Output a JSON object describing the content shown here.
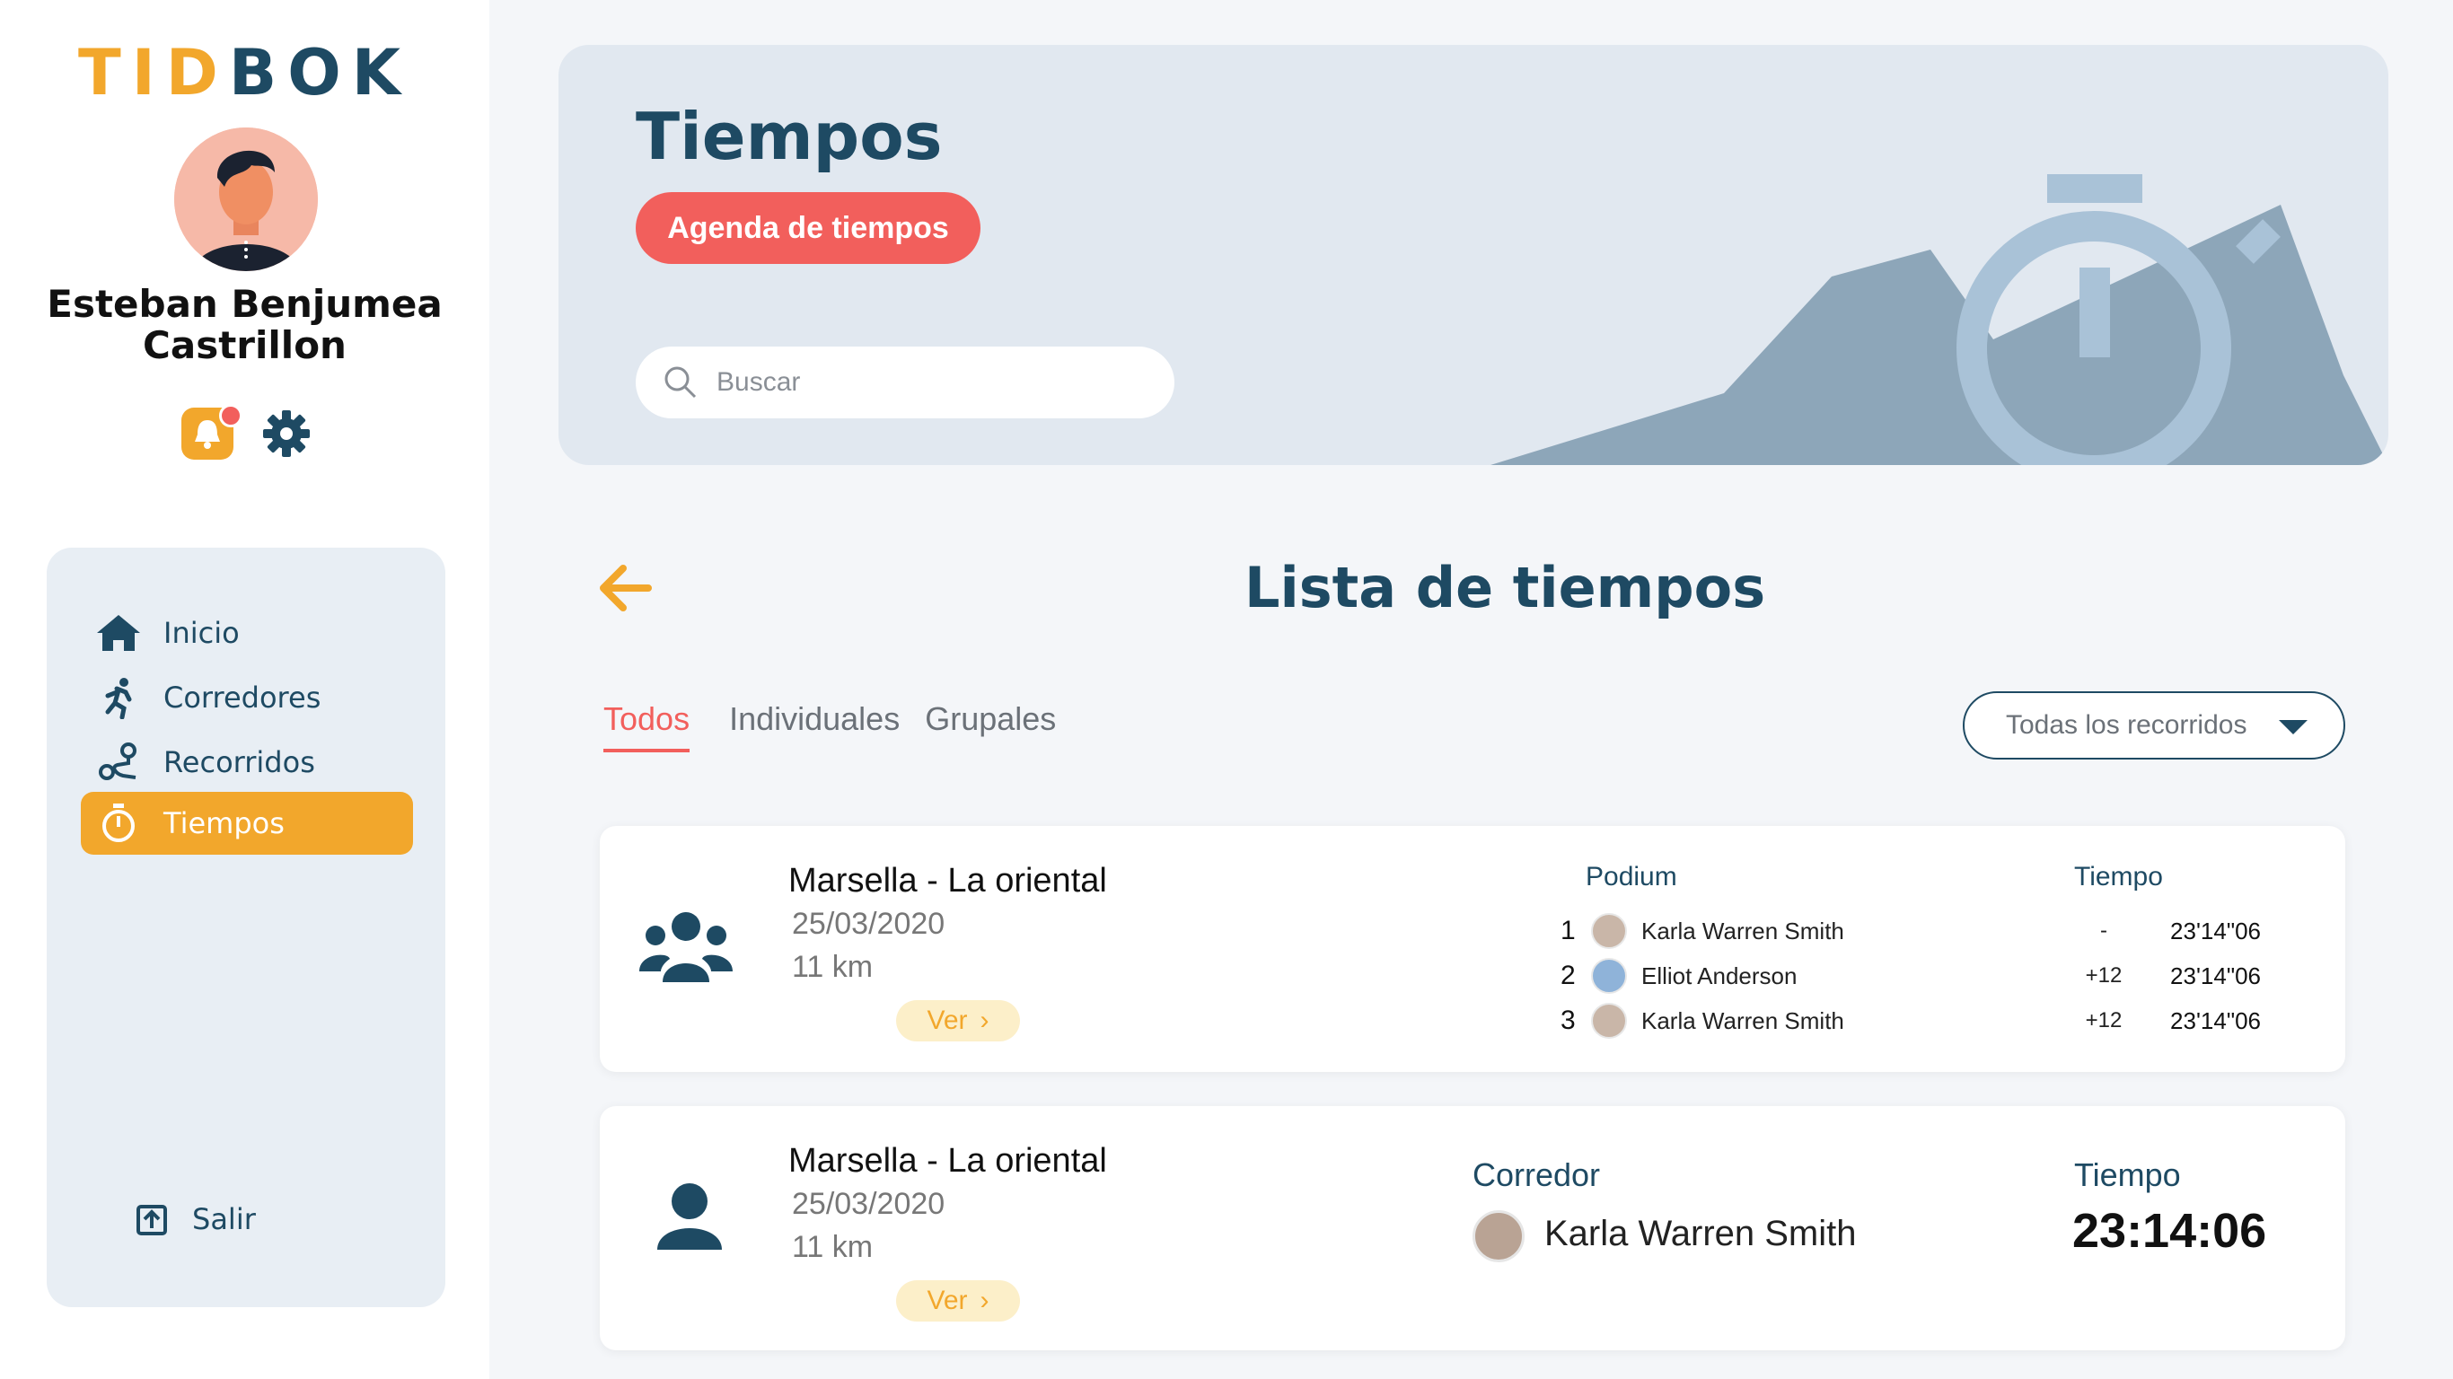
{
  "app": {
    "logo_part1": "TID",
    "logo_part2": "BOK"
  },
  "user": {
    "name": "Esteban Benjumea Castrillon"
  },
  "colors": {
    "accent": "#f2a72c",
    "primary": "#1e4a63",
    "danger": "#f25f5c",
    "banner_bg": "#e1e8f0"
  },
  "sidebar": {
    "items": [
      {
        "label": "Inicio",
        "icon": "home-icon"
      },
      {
        "label": "Corredores",
        "icon": "runner-icon"
      },
      {
        "label": "Recorridos",
        "icon": "route-icon"
      },
      {
        "label": "Tiempos",
        "icon": "stopwatch-icon",
        "active": true
      }
    ],
    "logout_label": "Salir"
  },
  "header": {
    "title": "Tiempos",
    "agenda_button": "Agenda de tiempos",
    "search_placeholder": "Buscar"
  },
  "main": {
    "section_title": "Lista de tiempos",
    "tabs": [
      {
        "label": "Todos",
        "active": true
      },
      {
        "label": "Individuales"
      },
      {
        "label": "Grupales"
      }
    ],
    "filter": {
      "selected": "Todas los recorridos"
    },
    "cards": [
      {
        "type": "group",
        "name": "Marsella - La oriental",
        "date": "25/03/2020",
        "distance": "11 km",
        "view_label": "Ver",
        "podium_label": "Podium",
        "time_label": "Tiempo",
        "podium": [
          {
            "pos": "1",
            "name": "Karla Warren Smith",
            "diff": "-",
            "time": "23'14\"06"
          },
          {
            "pos": "2",
            "name": "Elliot Anderson",
            "diff": "+12",
            "time": "23'14\"06"
          },
          {
            "pos": "3",
            "name": "Karla Warren Smith",
            "diff": "+12",
            "time": "23'14\"06"
          }
        ]
      },
      {
        "type": "individual",
        "name": "Marsella - La oriental",
        "date": "25/03/2020",
        "distance": "11 km",
        "view_label": "Ver",
        "runner_label": "Corredor",
        "time_label": "Tiempo",
        "runner": "Karla Warren Smith",
        "time": "23:14:06"
      }
    ]
  }
}
